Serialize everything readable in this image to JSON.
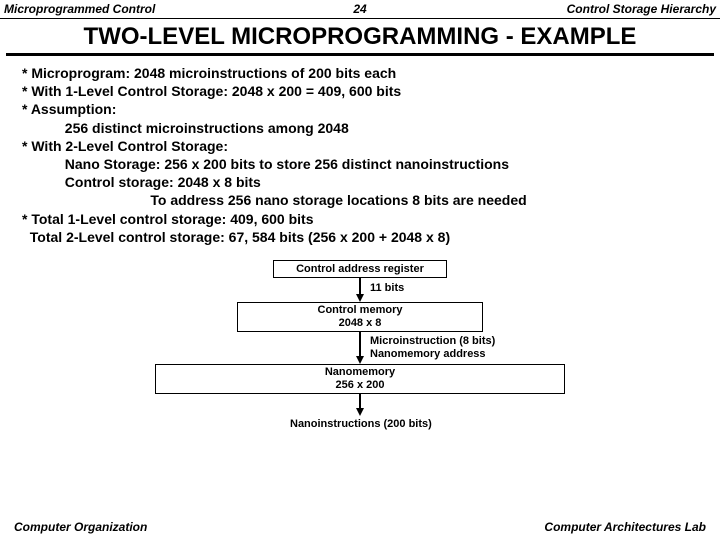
{
  "header": {
    "left": "Microprogrammed Control",
    "center": "24",
    "right": "Control Storage Hierarchy"
  },
  "title": "TWO-LEVEL  MICROPROGRAMMING  - EXAMPLE",
  "bullets": {
    "l1": "* Microprogram: 2048 microinstructions of 200 bits each",
    "l2": "* With 1-Level Control Storage: 2048 x 200 = 409, 600 bits",
    "l3": "* Assumption:",
    "l4": "           256 distinct microinstructions among 2048",
    "l5": "* With 2-Level Control Storage:",
    "l6": "           Nano Storage: 256 x 200 bits to store 256 distinct nanoinstructions",
    "l7": "           Control storage: 2048 x 8 bits",
    "l8": "                                 To address 256 nano storage locations 8 bits are needed",
    "l9": "* Total 1-Level control storage: 409, 600 bits",
    "l10": "  Total 2-Level control storage: 67, 584 bits (256 x 200 + 2048 x 8)"
  },
  "diagram": {
    "car": "Control address register",
    "bits11": "11 bits",
    "cm1": "Control memory",
    "cm2": "2048 x 8",
    "mi1": "Microinstruction (8 bits)",
    "mi2": "Nanomemory address",
    "nm1": "Nanomemory",
    "nm2": "256 x 200",
    "nano": "Nanoinstructions (200 bits)"
  },
  "footer": {
    "left": "Computer Organization",
    "right": "Computer Architectures Lab"
  }
}
